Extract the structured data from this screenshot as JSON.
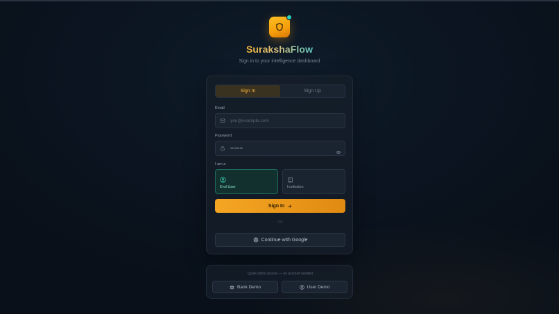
{
  "app": {
    "name": "SurakshaFlow",
    "tagline": "Sign in to your intelligence dashboard"
  },
  "auth_tabs": [
    {
      "label": "Sign In",
      "active": true
    },
    {
      "label": "Sign Up",
      "active": false
    }
  ],
  "form": {
    "email_label": "Email",
    "email_placeholder": "you@example.com",
    "password_label": "Password",
    "password_value": "••••••••",
    "role_label": "I am a",
    "roles": [
      {
        "label": "End User",
        "selected": true,
        "icon": "user-circle-icon"
      },
      {
        "label": "Institution",
        "selected": false,
        "icon": "building-icon"
      }
    ],
    "submit_label": "Sign In",
    "divider": "OR",
    "google_label": "Continue with Google"
  },
  "demo": {
    "note": "Quick demo access — no account needed",
    "bank_label": "Bank Demo",
    "user_label": "User Demo"
  },
  "colors": {
    "accent": "#f5a623",
    "teal": "#2dd4bf",
    "background": "#0b1420"
  }
}
